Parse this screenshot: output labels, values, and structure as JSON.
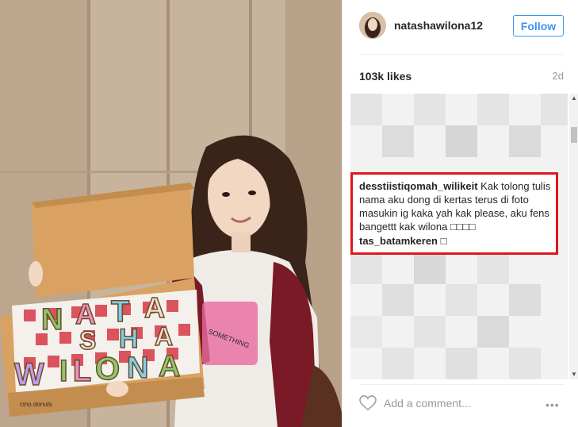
{
  "post": {
    "username": "natashawilona12",
    "follow_label": "Follow",
    "likes": "103k likes",
    "time": "2d"
  },
  "highlighted_comments": [
    {
      "user": "desstiistiqomah_wilikeit",
      "text": " Kak tolong tulis nama aku dong di kertas terus di foto masukin ig kaka yah kak please, aku fens bangettt kak wilona □□□□"
    },
    {
      "user": "tas_batamkeren",
      "text": " □"
    }
  ],
  "comment_box": {
    "placeholder": "Add a comment...",
    "more_label": "•••"
  },
  "photo": {
    "box_letters": [
      "N",
      "A",
      "T",
      "A",
      "S",
      "H",
      "A",
      "W",
      "I",
      "L",
      "O",
      "N",
      "A"
    ],
    "shirt_text": "SOMETHING",
    "box_brand": "cino donuts"
  },
  "colors": {
    "follow_blue": "#3897f0",
    "highlight_red": "#e0161e"
  }
}
